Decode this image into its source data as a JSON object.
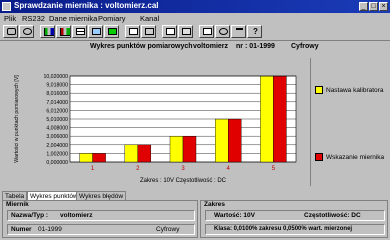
{
  "window": {
    "title": "Sprawdzanie miernika : voltomierz.cal"
  },
  "menu": {
    "items": [
      "Plik",
      "RS232",
      "Dane miernika",
      "Pomiary",
      "Kanal"
    ]
  },
  "chart_header": {
    "title": "Wykres punktów pomiarowych",
    "device_name": "voltomierz",
    "serial_prefix": "nr : 01-1999",
    "mode": "Cyfrowy"
  },
  "chart_data": {
    "type": "bar",
    "categories": [
      "1",
      "2",
      "3",
      "4",
      "5"
    ],
    "series": [
      {
        "name": "Nastawa kalibratora",
        "values": [
          1.0,
          2.0,
          3.0,
          5.0,
          10.0
        ],
        "color": "#ffff00"
      },
      {
        "name": "Wskazanie miernika",
        "values": [
          1.0,
          2.0,
          3.0,
          5.0,
          10.0
        ],
        "color": "#e00000"
      }
    ],
    "ylabel": "Wartości w punktach pomiarowych [V]",
    "ytick_labels": [
      "0,000000",
      "1,002000",
      "2,004000",
      "3,006000",
      "4,008000",
      "5,010000",
      "6,012000",
      "7,014000",
      "8,016000",
      "9,018000",
      "10,020000"
    ],
    "ylim": [
      0,
      10.02
    ],
    "grid": true,
    "legend_position": "right",
    "footer": "Zakres : 10V   Częstotliwość : DC"
  },
  "tabs": [
    "Tabela",
    "Wykres punktów",
    "Wykres błędów"
  ],
  "miernik": {
    "title": "Miernik",
    "name_label": "Nazwa/Typ :",
    "name_value": "voltomierz",
    "number_label": "Numer",
    "number_value": "01-1999",
    "type_value": "Cyfrowy"
  },
  "zakres": {
    "title": "Zakres",
    "value_label": "Wartość: 10V",
    "freq_label": "Częstotliwość: DC",
    "class_label": "Klasa: 0,0100% zakresu 0,0500% wart. mierzonej"
  },
  "colors": {
    "titlebar": "#0a1c8a",
    "bar_yellow": "#ffff00",
    "bar_red": "#e00000",
    "chart_bg": "#ffffff"
  }
}
